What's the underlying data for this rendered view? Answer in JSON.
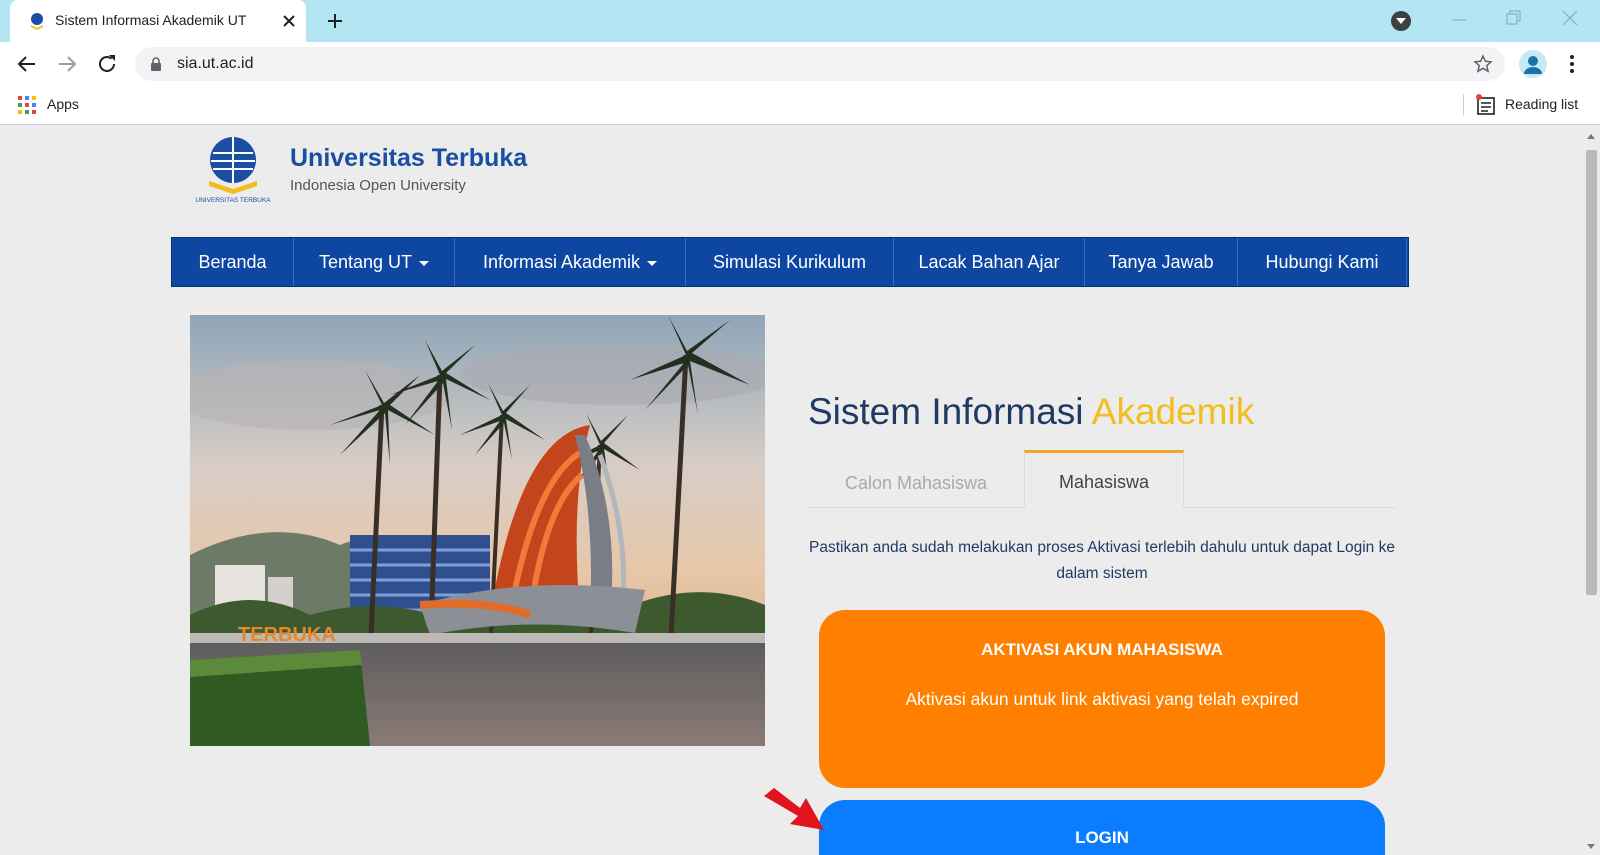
{
  "browser": {
    "tab_title": "Sistem Informasi Akademik UT",
    "url": "sia.ut.ac.id",
    "bookmarks": {
      "apps_label": "Apps",
      "reading_list_label": "Reading list"
    }
  },
  "site": {
    "logo_title": "Universitas Terbuka",
    "logo_subtitle": "Indonesia Open University",
    "logo_emblem_text": "UNIVERSITAS TERBUKA",
    "nav": [
      {
        "label": "Beranda",
        "dropdown": false
      },
      {
        "label": "Tentang UT",
        "dropdown": true
      },
      {
        "label": "Informasi Akademik",
        "dropdown": true
      },
      {
        "label": "Simulasi Kurikulum",
        "dropdown": false
      },
      {
        "label": "Lacak Bahan Ajar",
        "dropdown": false
      },
      {
        "label": "Tanya Jawab",
        "dropdown": false
      },
      {
        "label": "Hubungi Kami",
        "dropdown": false
      }
    ]
  },
  "hero": {
    "sign_text": "TERBUKA"
  },
  "main": {
    "title_part1": "Sistem Informasi",
    "title_part2": "Akademik",
    "tabs": [
      {
        "label": "Calon Mahasiswa",
        "active": false
      },
      {
        "label": "Mahasiswa",
        "active": true
      }
    ],
    "notice": "Pastikan anda sudah melakukan proses Aktivasi terlebih dahulu untuk dapat Login ke dalam sistem",
    "aktivasi": {
      "heading": "AKTIVASI AKUN MAHASISWA",
      "description": "Aktivasi akun untuk link aktivasi yang telah expired"
    },
    "login": {
      "heading": "LOGIN"
    }
  },
  "colors": {
    "brand_blue": "#0d47a1",
    "accent_yellow": "#f2bd1d",
    "aktivasi_orange": "#ff8000",
    "login_blue": "#0a7dff",
    "tab_underline": "#f5a623",
    "annotation_arrow": "#e0141c"
  }
}
